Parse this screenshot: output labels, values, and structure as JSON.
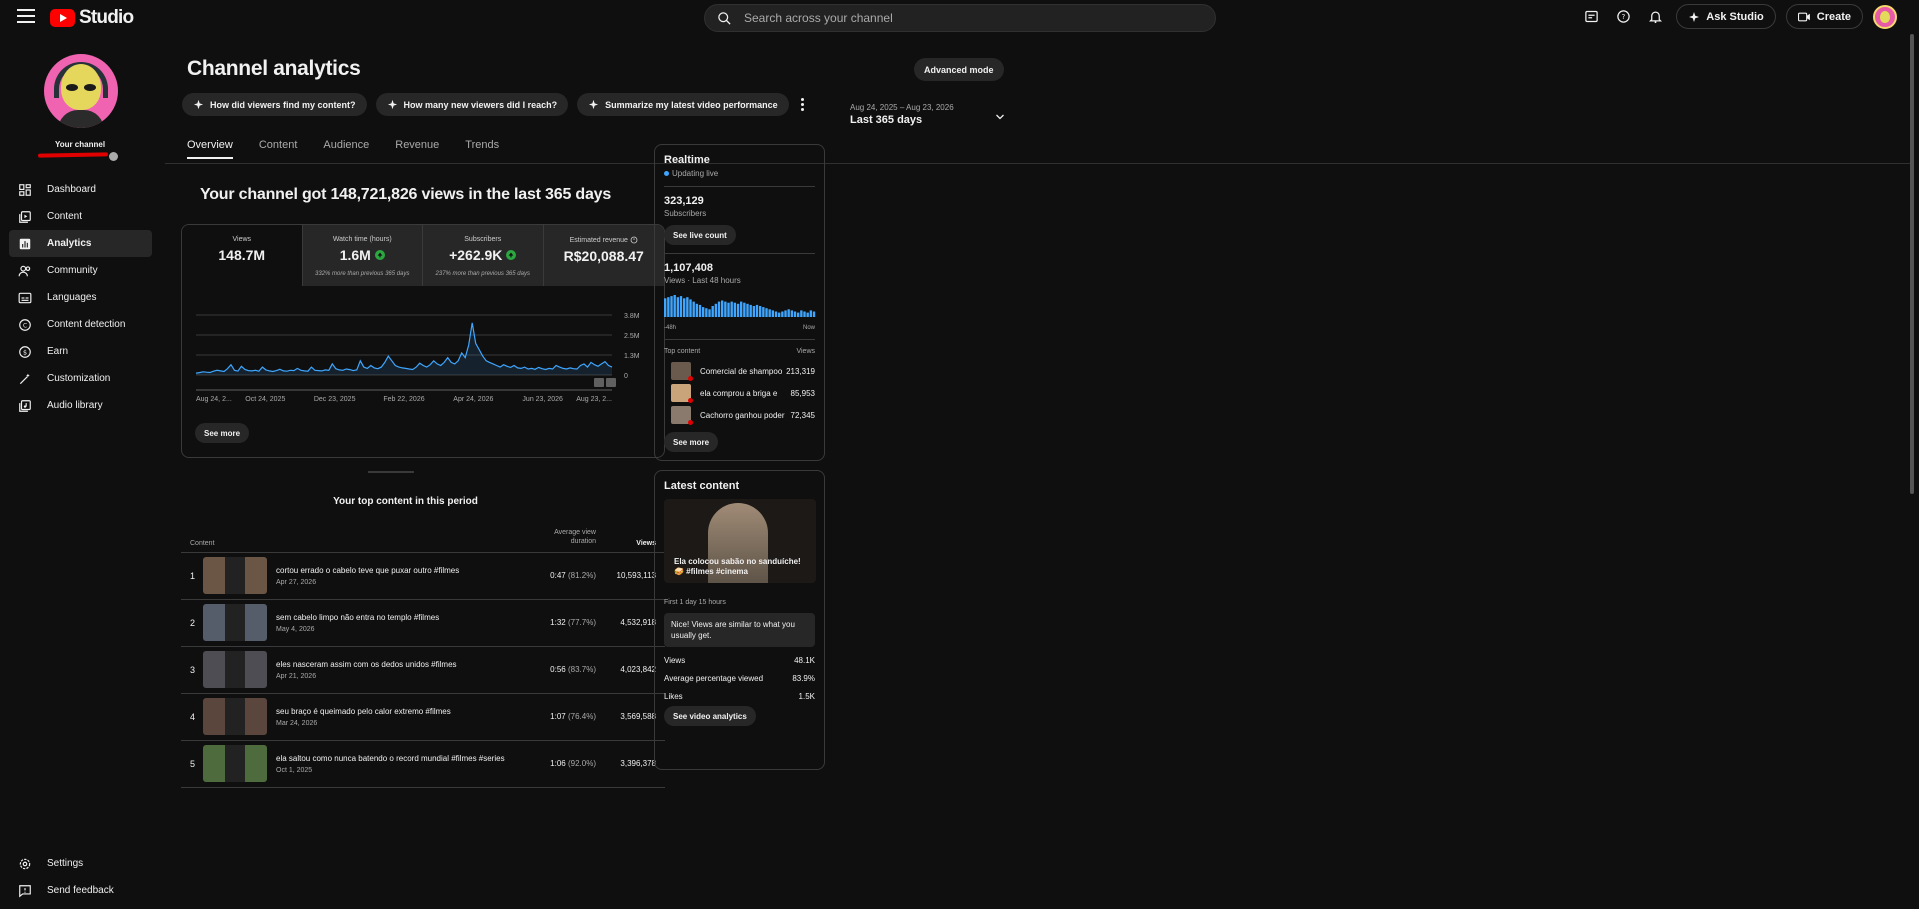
{
  "topbar": {
    "logo_text": "Studio",
    "search_placeholder": "Search across your channel",
    "ask_studio": "Ask Studio",
    "create": "Create"
  },
  "sidebar": {
    "your_channel": "Your channel",
    "items": [
      {
        "label": "Dashboard",
        "icon": "dashboard-icon"
      },
      {
        "label": "Content",
        "icon": "content-icon"
      },
      {
        "label": "Analytics",
        "icon": "analytics-icon"
      },
      {
        "label": "Community",
        "icon": "community-icon"
      },
      {
        "label": "Languages",
        "icon": "languages-icon"
      },
      {
        "label": "Content detection",
        "icon": "content-detection-icon"
      },
      {
        "label": "Earn",
        "icon": "earn-icon"
      },
      {
        "label": "Customization",
        "icon": "customization-icon"
      },
      {
        "label": "Audio library",
        "icon": "audio-library-icon"
      }
    ],
    "bottom": [
      {
        "label": "Settings",
        "icon": "settings-icon"
      },
      {
        "label": "Send feedback",
        "icon": "feedback-icon"
      }
    ]
  },
  "page": {
    "title": "Channel analytics",
    "advanced_mode": "Advanced mode",
    "chips": [
      "How did viewers find my content?",
      "How many new viewers did I reach?",
      "Summarize my latest video performance"
    ],
    "tabs": [
      "Overview",
      "Content",
      "Audience",
      "Revenue",
      "Trends"
    ],
    "date_range": "Aug 24, 2025 – Aug 23, 2026",
    "date_label": "Last 365 days",
    "headline": "Your channel got 148,721,826 views in the last 365 days"
  },
  "metrics": [
    {
      "label": "Views",
      "value": "148.7M",
      "note": ""
    },
    {
      "label": "Watch time (hours)",
      "value": "1.6M",
      "note": "332% more than previous 365 days"
    },
    {
      "label": "Subscribers",
      "value": "+262.9K",
      "note": "237% more than previous 365 days"
    },
    {
      "label": "Estimated revenue",
      "value": "R$20,088.47",
      "note": ""
    }
  ],
  "chart_data": {
    "type": "line",
    "y_ticks": [
      "3.8M",
      "2.5M",
      "1.3M",
      "0"
    ],
    "ylim": [
      0,
      3800000
    ],
    "x_ticks": [
      "Aug 24, 2...",
      "Oct 24, 2025",
      "Dec 23, 2025",
      "Feb 22, 2026",
      "Apr 24, 2026",
      "Jun 23, 2026",
      "Aug 23, 2..."
    ],
    "series": [
      {
        "values": [
          120000,
          150000,
          200000,
          180000,
          160000,
          240000,
          300000,
          260000,
          220000,
          400000,
          650000,
          300000,
          250000,
          550000,
          350000,
          280000,
          260000,
          300000,
          240000,
          500000,
          320000,
          260000,
          220000,
          280000,
          360000,
          260000,
          240000,
          300000,
          280000,
          420000,
          300000,
          260000,
          240000,
          500000,
          300000,
          280000,
          260000,
          320000,
          300000,
          700000,
          400000,
          320000,
          300000,
          380000,
          340000,
          280000,
          320000,
          900000,
          500000,
          420000,
          600000,
          450000,
          400000,
          500000,
          800000,
          1200000,
          900000,
          600000,
          500000,
          450000,
          420000,
          380000,
          350000,
          500000,
          750000,
          600000,
          500000,
          650000,
          900000,
          700000,
          600000,
          800000,
          1100000,
          800000,
          700000,
          900000,
          1400000,
          1100000,
          1900000,
          3300000,
          2000000,
          1600000,
          1200000,
          900000,
          800000,
          700000,
          600000,
          500000,
          650000,
          550000,
          480000,
          600000,
          450000,
          420000,
          500000,
          380000,
          420000,
          360000,
          480000,
          400000,
          350000,
          420000,
          380000,
          600000,
          500000,
          420000,
          380000,
          450000,
          400000,
          380000,
          600000,
          700000,
          500000,
          800000,
          650000,
          550000,
          700000,
          850000,
          600000,
          500000
        ]
      }
    ]
  },
  "see_more": "See more",
  "top_content": {
    "title": "Your top content in this period",
    "headers": {
      "content": "Content",
      "duration": "Average view duration",
      "views": "Views"
    },
    "rows": [
      {
        "rank": "1",
        "title": "cortou errado o cabelo teve que puxar outro #filmes",
        "date": "Apr 27, 2026",
        "duration": "0:47",
        "pct": "(81.2%)",
        "views": "10,593,113",
        "color": "#6b5544"
      },
      {
        "rank": "2",
        "title": "sem cabelo limpo não entra no templo #filmes",
        "date": "May 4, 2026",
        "duration": "1:32",
        "pct": "(77.7%)",
        "views": "4,532,918",
        "color": "#555c6a"
      },
      {
        "rank": "3",
        "title": "eles nasceram assim com os dedos unidos #filmes",
        "date": "Apr 21, 2026",
        "duration": "0:56",
        "pct": "(83.7%)",
        "views": "4,023,842",
        "color": "#4f4d54"
      },
      {
        "rank": "4",
        "title": "seu braço é queimado pelo calor extremo #filmes",
        "date": "Mar 24, 2026",
        "duration": "1:07",
        "pct": "(76.4%)",
        "views": "3,569,588",
        "color": "#5a463d"
      },
      {
        "rank": "5",
        "title": "ela saltou como nunca batendo o record mundial #filmes #series",
        "date": "Oct 1, 2025",
        "duration": "1:06",
        "pct": "(92.0%)",
        "views": "3,396,378",
        "color": "#4e6b3d"
      }
    ]
  },
  "realtime": {
    "title": "Realtime",
    "updating": "Updating live",
    "subscribers": "323,129",
    "subscribers_label": "Subscribers",
    "see_live": "See live count",
    "views": "1,107,408",
    "views_label": "Views · Last 48 hours",
    "axis_left": "-48h",
    "axis_right": "Now",
    "bars": [
      0.85,
      0.9,
      0.95,
      1.0,
      0.9,
      0.95,
      0.85,
      0.9,
      0.8,
      0.7,
      0.6,
      0.55,
      0.45,
      0.4,
      0.35,
      0.5,
      0.6,
      0.7,
      0.75,
      0.7,
      0.65,
      0.7,
      0.65,
      0.6,
      0.7,
      0.65,
      0.6,
      0.55,
      0.5,
      0.55,
      0.5,
      0.45,
      0.4,
      0.35,
      0.3,
      0.25,
      0.2,
      0.25,
      0.3,
      0.35,
      0.3,
      0.25,
      0.2,
      0.3,
      0.25,
      0.2,
      0.3,
      0.25
    ],
    "top_content_label": "Top content",
    "views_col": "Views",
    "items": [
      {
        "title": "Comercial de shampoo",
        "views": "213,319",
        "color": "#6a5a4d"
      },
      {
        "title": "ela comprou a briga e",
        "views": "85,953",
        "color": "#c9a37a"
      },
      {
        "title": "Cachorro ganhou poder",
        "views": "72,345",
        "color": "#8a7a6e"
      }
    ],
    "see_more": "See more"
  },
  "latest": {
    "title": "Latest content",
    "caption": "Ela colocou sabão no sanduíche! 🥪 #filmes #cinema",
    "first": "First 1 day 15 hours",
    "note": "Nice! Views are similar to what you usually get.",
    "stats": [
      {
        "label": "Views",
        "value": "48.1K"
      },
      {
        "label": "Average percentage viewed",
        "value": "83.9%"
      },
      {
        "label": "Likes",
        "value": "1.5K"
      }
    ],
    "see_analytics": "See video analytics"
  },
  "colors": {
    "accent": "#3ea6ff",
    "brand": "#ff0000",
    "positive": "#2ba640"
  }
}
